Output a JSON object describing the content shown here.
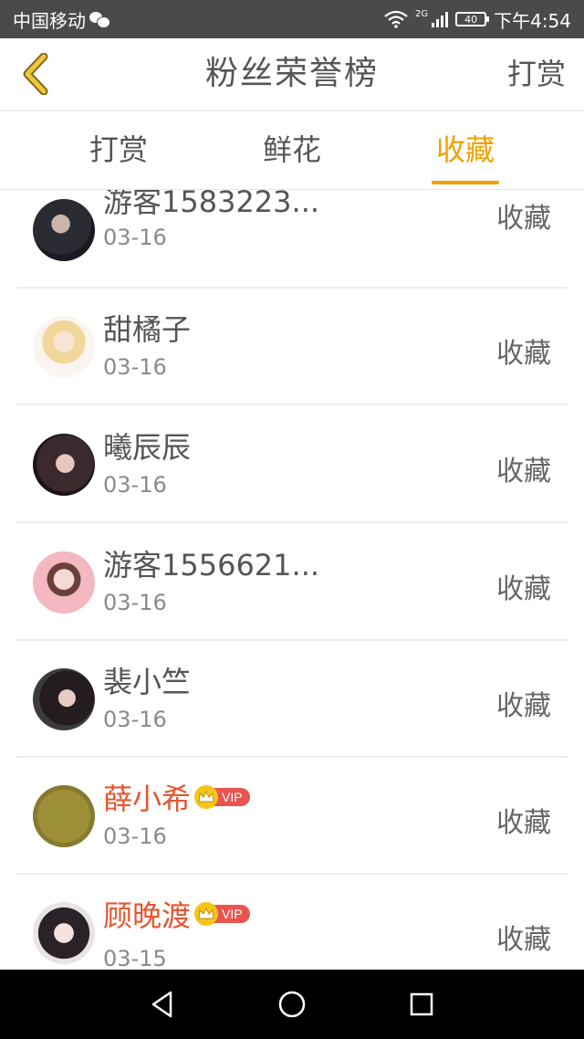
{
  "status_bar": {
    "carrier": "中国移动",
    "network": "2G",
    "battery": "40",
    "time": "下午4:54"
  },
  "header": {
    "title": "粉丝荣誉榜",
    "action_label": "打赏"
  },
  "tabs": [
    {
      "label": "打赏",
      "active": false
    },
    {
      "label": "鲜花",
      "active": false
    },
    {
      "label": "收藏",
      "active": true
    }
  ],
  "list": [
    {
      "name": "游客1583223...",
      "date": "03-16",
      "action": "收藏",
      "vip": false
    },
    {
      "name": "甜橘子",
      "date": "03-16",
      "action": "收藏",
      "vip": false
    },
    {
      "name": "曦辰辰",
      "date": "03-16",
      "action": "收藏",
      "vip": false
    },
    {
      "name": "游客1556621...",
      "date": "03-16",
      "action": "收藏",
      "vip": false
    },
    {
      "name": "裴小竺",
      "date": "03-16",
      "action": "收藏",
      "vip": false
    },
    {
      "name": "薛小希",
      "date": "03-16",
      "action": "收藏",
      "vip": true,
      "vip_label": "VIP"
    },
    {
      "name": "顾晚渡",
      "date": "03-15",
      "action": "收藏",
      "vip": true,
      "vip_label": "VIP"
    }
  ],
  "colors": {
    "accent": "#f0a000",
    "vip_name": "#e8542e",
    "status_bar": "#4a4a4a"
  },
  "icons": {
    "back": "chevron-left-icon",
    "nav_back": "triangle-back-icon",
    "nav_home": "circle-home-icon",
    "nav_recent": "square-recent-icon"
  }
}
